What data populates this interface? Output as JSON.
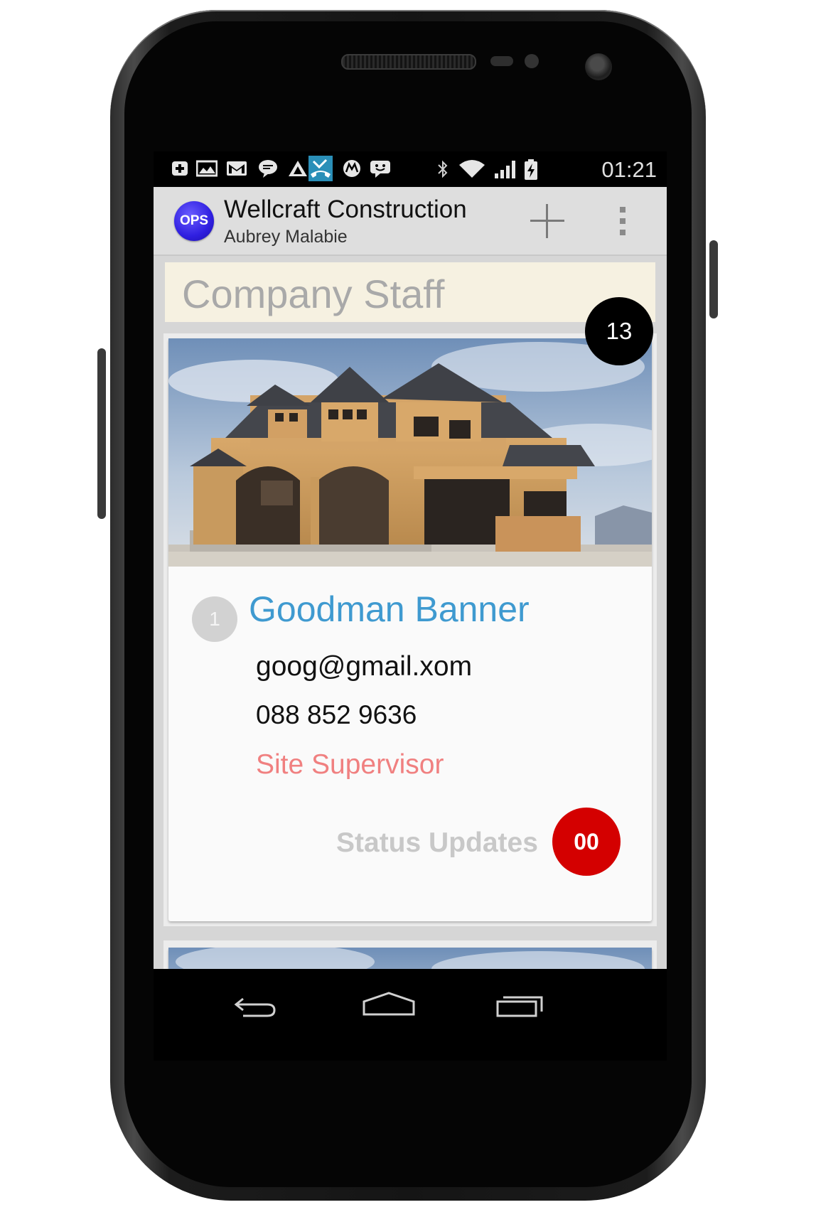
{
  "status_bar": {
    "time": "01:21",
    "icons": [
      "add-notification-icon",
      "photo-mail-icon",
      "gmail-icon",
      "chat-icon",
      "app-icon",
      "missed-call-icon",
      "motorola-icon",
      "messenger-icon",
      "bluetooth-icon",
      "wifi-icon",
      "signal-icon",
      "battery-icon"
    ]
  },
  "action_bar": {
    "logo_text": "OPS",
    "title": "Wellcraft Construction",
    "subtitle": "Aubrey Malabie"
  },
  "section": {
    "title": "Company Staff",
    "count": "13"
  },
  "staff": [
    {
      "index": "1",
      "name": "Goodman Banner",
      "email": "goog@gmail.xom",
      "phone": "088 852 9636",
      "role": "Site Supervisor",
      "status_label": "Status Updates",
      "status_count": "00"
    }
  ],
  "colors": {
    "accent_blue": "#3f9ad0",
    "role_pink": "#f08080",
    "status_red": "#d40000",
    "header_cream": "#f6f1e1"
  },
  "nav_bar": {
    "icons": [
      "back-icon",
      "home-icon",
      "recent-apps-icon"
    ]
  }
}
